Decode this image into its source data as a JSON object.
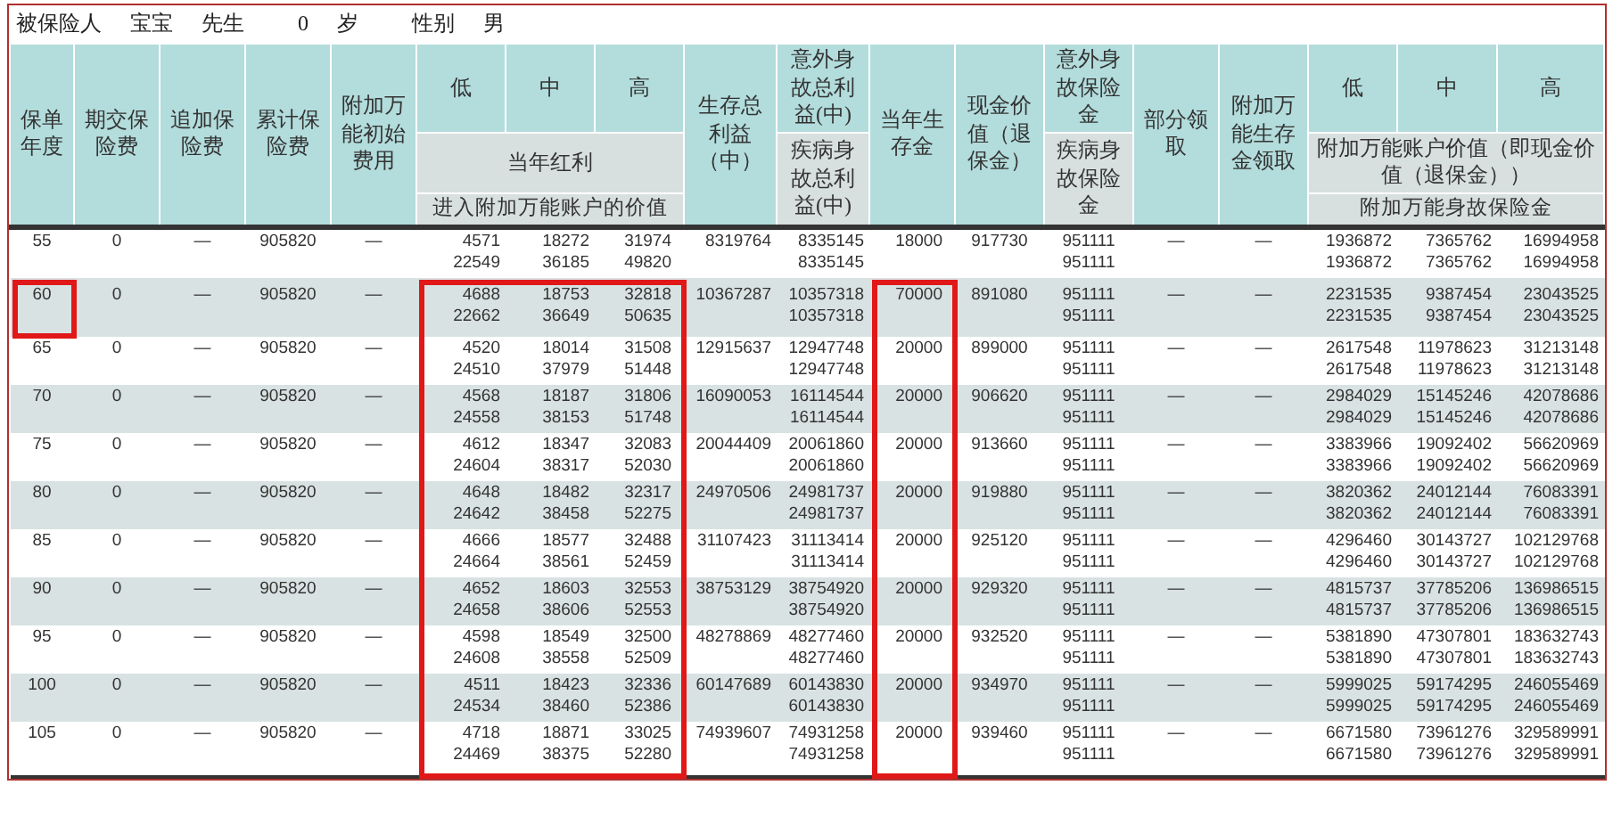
{
  "insured": {
    "label": "被保险人",
    "name": "宝宝",
    "title": "先生",
    "age": "0",
    "age_unit": "岁",
    "gender_label": "性别",
    "gender": "男"
  },
  "table": {
    "header": {
      "columns_left": [
        "保单年度",
        "期交保险费",
        "追加保险费",
        "累计保险费",
        "附加万能初始费用"
      ],
      "dividend_group": {
        "levels": [
          "低",
          "中",
          "高"
        ],
        "row_2": "当年红利",
        "row_3": "进入附加万能账户的价值"
      },
      "survival_benefit": "生存总利益（中）",
      "death_benefit_total": {
        "accident": "意外身故总利益(中)",
        "illness": "疾病身故总利益(中)"
      },
      "current_survival": "当年生存金",
      "cash_value": "现金价值（退保金）",
      "death_benefit": {
        "accident": "意外身故保险金",
        "illness": "疾病身故保险金"
      },
      "partial_withdrawal": "部分领取",
      "survival_withdrawal": "附加万能生存金领取",
      "account_group": {
        "levels": [
          "低",
          "中",
          "高"
        ],
        "row_2": "附加万能账户价值（即现金价值（退保金））",
        "row_3": "附加万能身故保险金"
      }
    },
    "rows": [
      {
        "year": "55",
        "year_highlighted": false,
        "highlighted": false,
        "cells": [
          [
            "0"
          ],
          [
            "—"
          ],
          [
            "905820"
          ],
          [
            "—"
          ],
          [
            "4571",
            "22549"
          ],
          [
            "18272",
            "36185"
          ],
          [
            "31974",
            "49820"
          ],
          [
            "8319764"
          ],
          [
            "8335145",
            "8335145"
          ],
          [
            "18000"
          ],
          [
            "917730"
          ],
          [
            "951111",
            "951111"
          ],
          [
            "—"
          ],
          [
            "—"
          ],
          [
            "1936872",
            "1936872"
          ],
          [
            "7365762",
            "7365762"
          ],
          [
            "16994958",
            "16994958"
          ]
        ]
      },
      {
        "year": "60",
        "year_highlighted": true,
        "highlighted": true,
        "cells": [
          [
            "0"
          ],
          [
            "—"
          ],
          [
            "905820"
          ],
          [
            "—"
          ],
          [
            "4688",
            "22662"
          ],
          [
            "18753",
            "36649"
          ],
          [
            "32818",
            "50635"
          ],
          [
            "10367287"
          ],
          [
            "10357318",
            "10357318"
          ],
          [
            "70000"
          ],
          [
            "891080"
          ],
          [
            "951111",
            "951111"
          ],
          [
            "—"
          ],
          [
            "—"
          ],
          [
            "2231535",
            "2231535"
          ],
          [
            "9387454",
            "9387454"
          ],
          [
            "23043525",
            "23043525"
          ]
        ]
      },
      {
        "year": "65",
        "year_highlighted": false,
        "highlighted": true,
        "cells": [
          [
            "0"
          ],
          [
            "—"
          ],
          [
            "905820"
          ],
          [
            "—"
          ],
          [
            "4520",
            "24510"
          ],
          [
            "18014",
            "37979"
          ],
          [
            "31508",
            "51448"
          ],
          [
            "12915637"
          ],
          [
            "12947748",
            "12947748"
          ],
          [
            "20000"
          ],
          [
            "899000"
          ],
          [
            "951111",
            "951111"
          ],
          [
            "—"
          ],
          [
            "—"
          ],
          [
            "2617548",
            "2617548"
          ],
          [
            "11978623",
            "11978623"
          ],
          [
            "31213148",
            "31213148"
          ]
        ]
      },
      {
        "year": "70",
        "year_highlighted": false,
        "highlighted": true,
        "cells": [
          [
            "0"
          ],
          [
            "—"
          ],
          [
            "905820"
          ],
          [
            "—"
          ],
          [
            "4568",
            "24558"
          ],
          [
            "18187",
            "38153"
          ],
          [
            "31806",
            "51748"
          ],
          [
            "16090053"
          ],
          [
            "16114544",
            "16114544"
          ],
          [
            "20000"
          ],
          [
            "906620"
          ],
          [
            "951111",
            "951111"
          ],
          [
            "—"
          ],
          [
            "—"
          ],
          [
            "2984029",
            "2984029"
          ],
          [
            "15145246",
            "15145246"
          ],
          [
            "42078686",
            "42078686"
          ]
        ]
      },
      {
        "year": "75",
        "year_highlighted": false,
        "highlighted": true,
        "cells": [
          [
            "0"
          ],
          [
            "—"
          ],
          [
            "905820"
          ],
          [
            "—"
          ],
          [
            "4612",
            "24604"
          ],
          [
            "18347",
            "38317"
          ],
          [
            "32083",
            "52030"
          ],
          [
            "20044409"
          ],
          [
            "20061860",
            "20061860"
          ],
          [
            "20000"
          ],
          [
            "913660"
          ],
          [
            "951111",
            "951111"
          ],
          [
            "—"
          ],
          [
            "—"
          ],
          [
            "3383966",
            "3383966"
          ],
          [
            "19092402",
            "19092402"
          ],
          [
            "56620969",
            "56620969"
          ]
        ]
      },
      {
        "year": "80",
        "year_highlighted": false,
        "highlighted": true,
        "cells": [
          [
            "0"
          ],
          [
            "—"
          ],
          [
            "905820"
          ],
          [
            "—"
          ],
          [
            "4648",
            "24642"
          ],
          [
            "18482",
            "38458"
          ],
          [
            "32317",
            "52275"
          ],
          [
            "24970506"
          ],
          [
            "24981737",
            "24981737"
          ],
          [
            "20000"
          ],
          [
            "919880"
          ],
          [
            "951111",
            "951111"
          ],
          [
            "—"
          ],
          [
            "—"
          ],
          [
            "3820362",
            "3820362"
          ],
          [
            "24012144",
            "24012144"
          ],
          [
            "76083391",
            "76083391"
          ]
        ]
      },
      {
        "year": "85",
        "year_highlighted": false,
        "highlighted": true,
        "cells": [
          [
            "0"
          ],
          [
            "—"
          ],
          [
            "905820"
          ],
          [
            "—"
          ],
          [
            "4666",
            "24664"
          ],
          [
            "18577",
            "38561"
          ],
          [
            "32488",
            "52459"
          ],
          [
            "31107423"
          ],
          [
            "31113414",
            "31113414"
          ],
          [
            "20000"
          ],
          [
            "925120"
          ],
          [
            "951111",
            "951111"
          ],
          [
            "—"
          ],
          [
            "—"
          ],
          [
            "4296460",
            "4296460"
          ],
          [
            "30143727",
            "30143727"
          ],
          [
            "102129768",
            "102129768"
          ]
        ]
      },
      {
        "year": "90",
        "year_highlighted": false,
        "highlighted": true,
        "cells": [
          [
            "0"
          ],
          [
            "—"
          ],
          [
            "905820"
          ],
          [
            "—"
          ],
          [
            "4652",
            "24658"
          ],
          [
            "18603",
            "38606"
          ],
          [
            "32553",
            "52553"
          ],
          [
            "38753129"
          ],
          [
            "38754920",
            "38754920"
          ],
          [
            "20000"
          ],
          [
            "929320"
          ],
          [
            "951111",
            "951111"
          ],
          [
            "—"
          ],
          [
            "—"
          ],
          [
            "4815737",
            "4815737"
          ],
          [
            "37785206",
            "37785206"
          ],
          [
            "136986515",
            "136986515"
          ]
        ]
      },
      {
        "year": "95",
        "year_highlighted": false,
        "highlighted": true,
        "cells": [
          [
            "0"
          ],
          [
            "—"
          ],
          [
            "905820"
          ],
          [
            "—"
          ],
          [
            "4598",
            "24608"
          ],
          [
            "18549",
            "38558"
          ],
          [
            "32500",
            "52509"
          ],
          [
            "48278869"
          ],
          [
            "48277460",
            "48277460"
          ],
          [
            "20000"
          ],
          [
            "932520"
          ],
          [
            "951111",
            "951111"
          ],
          [
            "—"
          ],
          [
            "—"
          ],
          [
            "5381890",
            "5381890"
          ],
          [
            "47307801",
            "47307801"
          ],
          [
            "183632743",
            "183632743"
          ]
        ]
      },
      {
        "year": "100",
        "year_highlighted": false,
        "highlighted": true,
        "cells": [
          [
            "0"
          ],
          [
            "—"
          ],
          [
            "905820"
          ],
          [
            "—"
          ],
          [
            "4511",
            "24534"
          ],
          [
            "18423",
            "38460"
          ],
          [
            "32336",
            "52386"
          ],
          [
            "60147689"
          ],
          [
            "60143830",
            "60143830"
          ],
          [
            "20000"
          ],
          [
            "934970"
          ],
          [
            "951111",
            "951111"
          ],
          [
            "—"
          ],
          [
            "—"
          ],
          [
            "5999025",
            "5999025"
          ],
          [
            "59174295",
            "59174295"
          ],
          [
            "246055469",
            "246055469"
          ]
        ]
      },
      {
        "year": "105",
        "year_highlighted": false,
        "highlighted": true,
        "cells": [
          [
            "0"
          ],
          [
            "—"
          ],
          [
            "905820"
          ],
          [
            "—"
          ],
          [
            "4718",
            "24469"
          ],
          [
            "18871",
            "38375"
          ],
          [
            "33025",
            "52280"
          ],
          [
            "74939607"
          ],
          [
            "74931258",
            "74931258"
          ],
          [
            "20000"
          ],
          [
            "939460"
          ],
          [
            "951111",
            "951111"
          ],
          [
            "—"
          ],
          [
            "—"
          ],
          [
            "6671580",
            "6671580"
          ],
          [
            "73961276",
            "73961276"
          ],
          [
            "329589991",
            "329589991"
          ]
        ]
      }
    ]
  }
}
